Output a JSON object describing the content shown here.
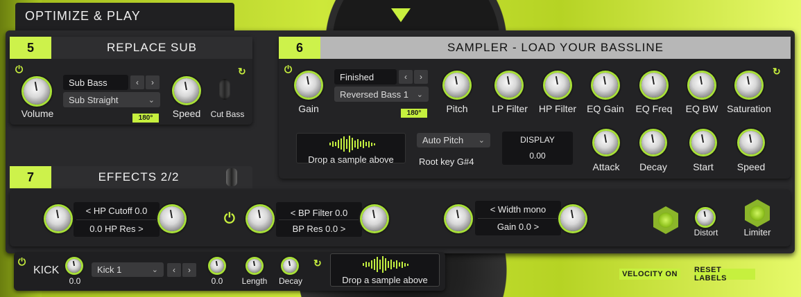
{
  "top": {
    "title": "OPTIMIZE & PLAY"
  },
  "replace_sub": {
    "number": "5",
    "title": "REPLACE SUB",
    "preset": "Sub Bass",
    "variant": "Sub Straight",
    "badge": "180°",
    "volume_label": "Volume",
    "speed_label": "Speed",
    "cut_bass_label": "Cut Bass"
  },
  "sampler": {
    "number": "6",
    "title": "SAMPLER - LOAD YOUR BASSLINE",
    "preset": "Finished",
    "variant": "Reversed Bass 1",
    "badge": "180°",
    "knobs_top": [
      "Gain",
      "Pitch",
      "LP Filter",
      "HP Filter",
      "EQ Gain",
      "EQ Freq",
      "EQ BW",
      "Saturation"
    ],
    "knobs_bottom": [
      "Attack",
      "Decay",
      "Start",
      "Speed"
    ],
    "drop_text": "Drop a sample above",
    "auto_pitch": "Auto Pitch",
    "root_key": "Root key G#4",
    "display_label": "DISPLAY",
    "display_value": "0.00"
  },
  "effects": {
    "number": "7",
    "title": "EFFECTS 2/2",
    "hp_cutoff": "< HP Cutoff 0.0",
    "hp_res": "0.0 HP Res >",
    "bp_filter": "< BP Filter 0.0",
    "bp_res": "BP Res 0.0 >",
    "width": "< Width mono",
    "gain": "Gain 0.0 >",
    "distort_label": "Distort",
    "limiter_label": "Limiter"
  },
  "kick": {
    "title": "KICK",
    "preset": "Kick 1",
    "val1": "0.0",
    "val2": "0.0",
    "length_label": "Length",
    "decay_label": "Decay",
    "drop_text": "Drop a sample above"
  },
  "buttons": {
    "velocity": "VELOCITY ON",
    "reset": "RESET LABELS"
  }
}
